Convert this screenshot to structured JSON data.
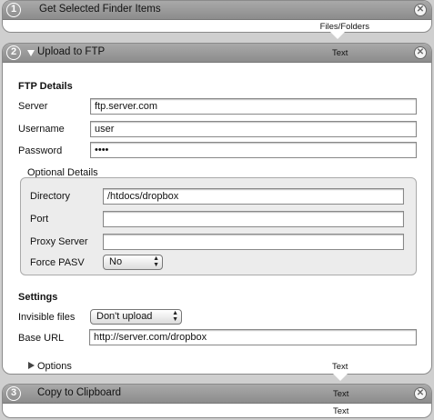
{
  "actions": [
    {
      "number": "1",
      "title": "Get Selected Finder Items",
      "output": "Files/Folders"
    },
    {
      "number": "2",
      "title": "Upload to FTP",
      "input": "Text",
      "output": "Text"
    },
    {
      "number": "3",
      "title": "Copy to Clipboard",
      "input": "Text",
      "output": "Text"
    }
  ],
  "ftp": {
    "heading": "FTP Details",
    "server_label": "Server",
    "server_value": "ftp.server.com",
    "username_label": "Username",
    "username_value": "user",
    "password_label": "Password",
    "password_value": "••••"
  },
  "optional": {
    "heading": "Optional Details",
    "directory_label": "Directory",
    "directory_value": "/htdocs/dropbox",
    "port_label": "Port",
    "port_value": "",
    "proxy_label": "Proxy Server",
    "proxy_value": "",
    "pasv_label": "Force PASV",
    "pasv_value": "No"
  },
  "settings": {
    "heading": "Settings",
    "invisible_label": "Invisible files",
    "invisible_value": "Don't upload",
    "baseurl_label": "Base URL",
    "baseurl_value": "http://server.com/dropbox"
  },
  "footer": {
    "options_label": "Options"
  },
  "icons": {
    "close": "close-icon",
    "disclosure": "disclosure-triangle-icon",
    "popup": "popup-arrows-icon"
  }
}
